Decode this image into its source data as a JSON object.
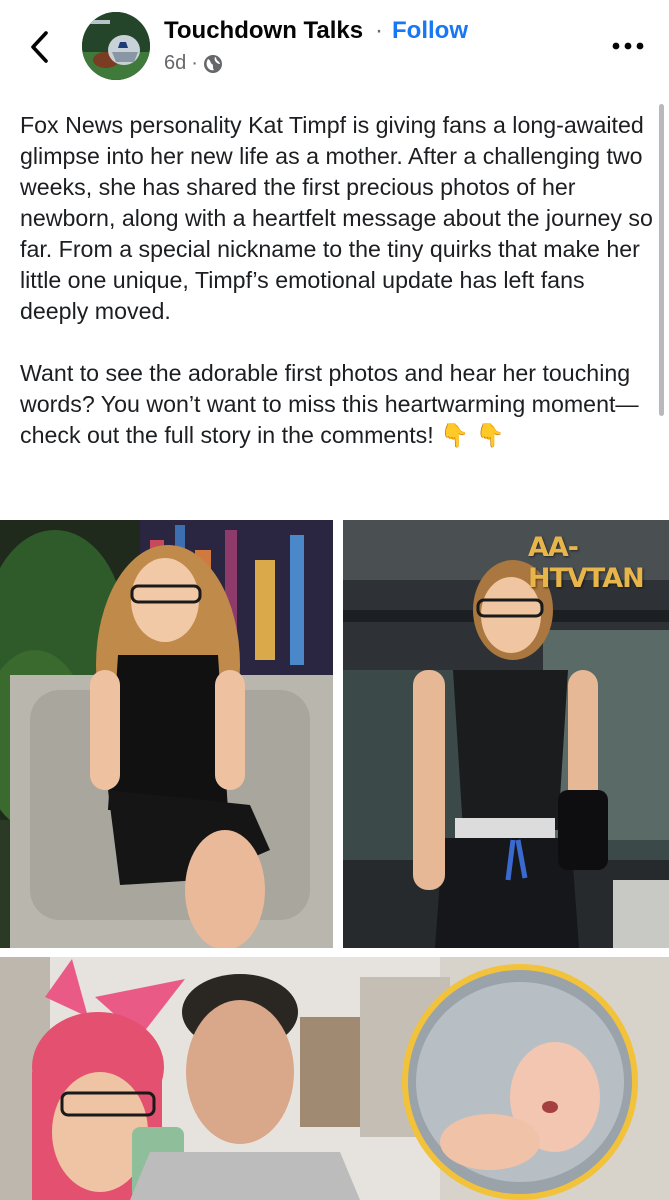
{
  "header": {
    "page_name": "Touchdown Talks",
    "separator": "·",
    "follow_label": "Follow",
    "time_ago": "6d",
    "meta_separator": "·",
    "privacy_icon": "globe-icon",
    "back_icon": "chevron-left-icon",
    "more_icon": "more-dots-icon"
  },
  "post": {
    "paragraph_1": "Fox News personality Kat Timpf is giving fans a long-awaited glimpse into her new life as a mother. After a challenging two weeks, she has shared the first precious photos of her newborn, along with a heartfelt message about the journey so far. From a special nickname to the tiny quirks that make her little one unique, Timpf’s emotional update has left fans deeply moved.",
    "paragraph_2": "Want to see the adorable first photos and hear her touching words? You won’t want to miss this heartwarming moment—check out the full story in the comments! 👇 👇"
  },
  "photos": {
    "watermark": "AA-HTVTAN"
  },
  "colors": {
    "accent": "#1877f2",
    "secondary_text": "#65676b"
  }
}
